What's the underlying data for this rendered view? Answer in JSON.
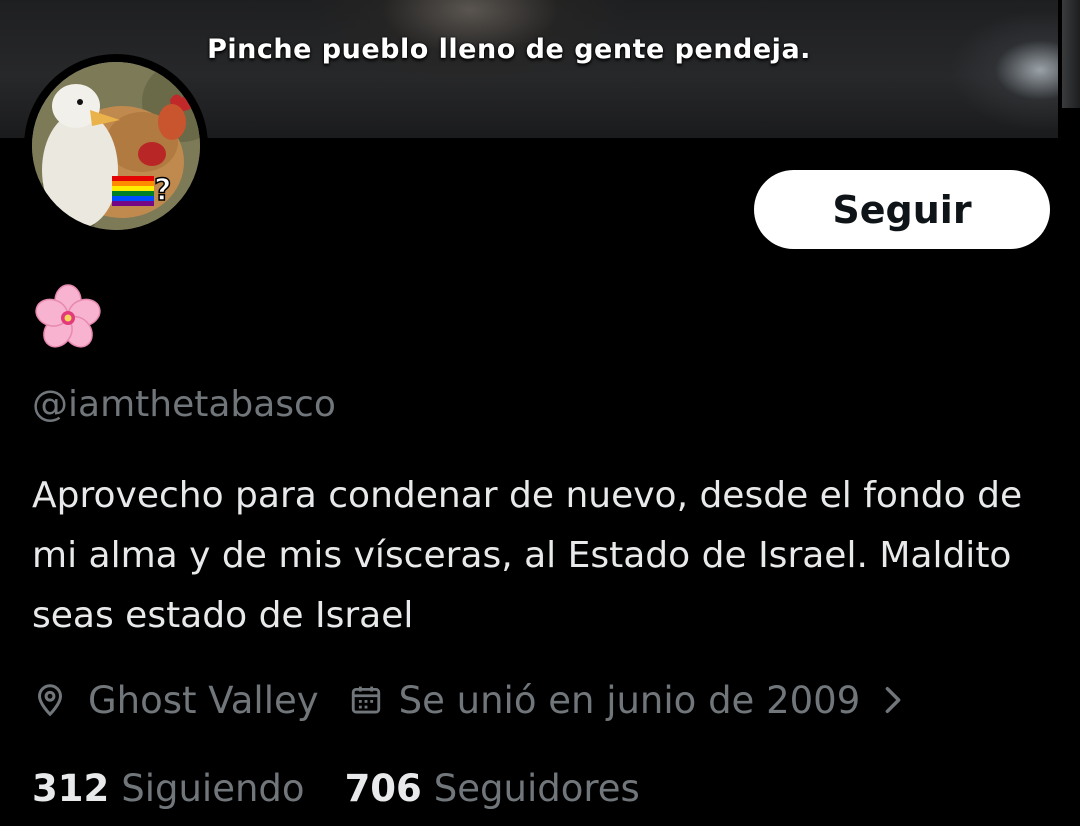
{
  "banner": {
    "caption": "Pinche pueblo lleno de gente pendeja."
  },
  "profile": {
    "avatar_icon": "chicken-duck-avatar",
    "display_name_icon": "cherry-blossom-icon",
    "handle": "@iamthetabasco",
    "bio": "Aprovecho para condenar de nuevo, desde el fondo de mi alma y de mis vísceras, al Estado de Israel. Maldito seas estado de Israel",
    "location": "Ghost Valley",
    "joined": "Se unió en junio de 2009",
    "follow_label": "Seguir"
  },
  "stats": {
    "following_count": "312",
    "following_label": "Siguiendo",
    "followers_count": "706",
    "followers_label": "Seguidores"
  },
  "colors": {
    "background": "#000000",
    "primary_text": "#e7e9ea",
    "secondary_text": "#71767b",
    "button_bg": "#ffffff",
    "button_text": "#0f1419"
  }
}
